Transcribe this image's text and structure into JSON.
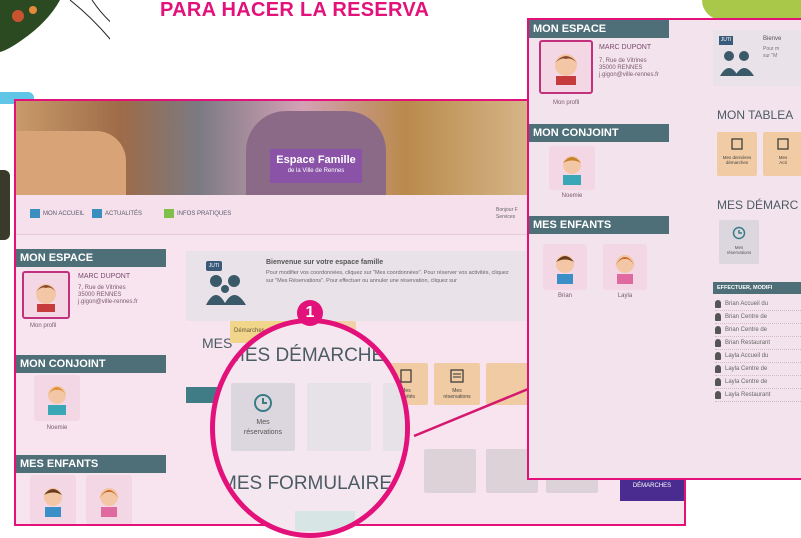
{
  "heading": "PARA HACER LA RESERVA",
  "banner": {
    "title": "Espace Famille",
    "subtitle": "de la Ville de Rennes"
  },
  "nav": {
    "items": [
      "MON ACCUEIL",
      "ACTUALITÉS",
      "INFOS PRATIQUES"
    ],
    "right_text": [
      "Bonjour F",
      "Services"
    ]
  },
  "left_panel": {
    "mon_espace": "MON ESPACE",
    "user_name": "MARC DUPONT",
    "user_address": [
      "7, Rue de Vitrines",
      "35000 RENNES",
      "j.gigon@ville-rennes.fr"
    ],
    "profile_link": "Mon profil",
    "mon_conjoint": "MON CONJOINT",
    "conjoint_name": "Noemie",
    "mes_enfants": "MES ENFANTS",
    "children": [
      "Brian",
      "Layla"
    ]
  },
  "welcome": {
    "badge": "JUTI",
    "title": "Bienvenue sur votre espace famille",
    "body": "Pour modifier vos coordonnées, cliquez sur \"Mes coordonnées\". Pour réserver vos activités, cliquez sur \"Mes Réservations\". Pour effectuer ou annuler une réservation, cliquez sur"
  },
  "mid": {
    "tab_1": "Démarches",
    "tab_2": "échéances",
    "mes_label": "MES"
  },
  "magnifier": {
    "number": "1",
    "mes_demarches": "MES DÉMARCHES",
    "tile_label": [
      "Mes",
      "réservations"
    ],
    "mes_formulaires": "MES FORMULAIRES",
    "bottom_cut": "MES"
  },
  "tiles_right": {
    "tile_a": "Mes\nactivités",
    "tile_b": "Mes\nréservations"
  },
  "purple_button": "DÉMARCHES",
  "right_panel": {
    "mon_espace": "MON ESPACE",
    "user_name": "MARC DUPONT",
    "user_address": [
      "7, Rue de Vitrines",
      "35000 RENNES",
      "j.gigon@ville-rennes.fr"
    ],
    "profile_link": "Mon profil",
    "mon_conjoint": "MON CONJOINT",
    "conjoint_name": "Noemie",
    "mes_enfants": "MES ENFANTS",
    "children": [
      "Brian",
      "Layla"
    ],
    "badge": "JUTI",
    "welcome_title": "Bienve",
    "welcome_lines": [
      "Pour m",
      "sur \"M"
    ],
    "tableau": "MON TABLEA",
    "tableau_tiles": [
      "Mes dernières\ndémarches",
      "Mes\nActi"
    ],
    "demarches": "MES DÉMARC",
    "res_tile": [
      "Mes",
      "réservations"
    ],
    "table_header": "EFFECTUER, MODIFI",
    "rows": [
      "Brian   Accueil du",
      "Brian   Centre de",
      "Brian   Centre de",
      "Brian   Restaurant",
      "Layla   Accueil du",
      "Layla   Centre de",
      "Layla   Centre de",
      "Layla   Restaurant"
    ]
  },
  "colors": {
    "accent": "#e2127a",
    "section_bar": "#4f6f78",
    "purple": "#4a2c91",
    "arrow": "#d4176f"
  }
}
